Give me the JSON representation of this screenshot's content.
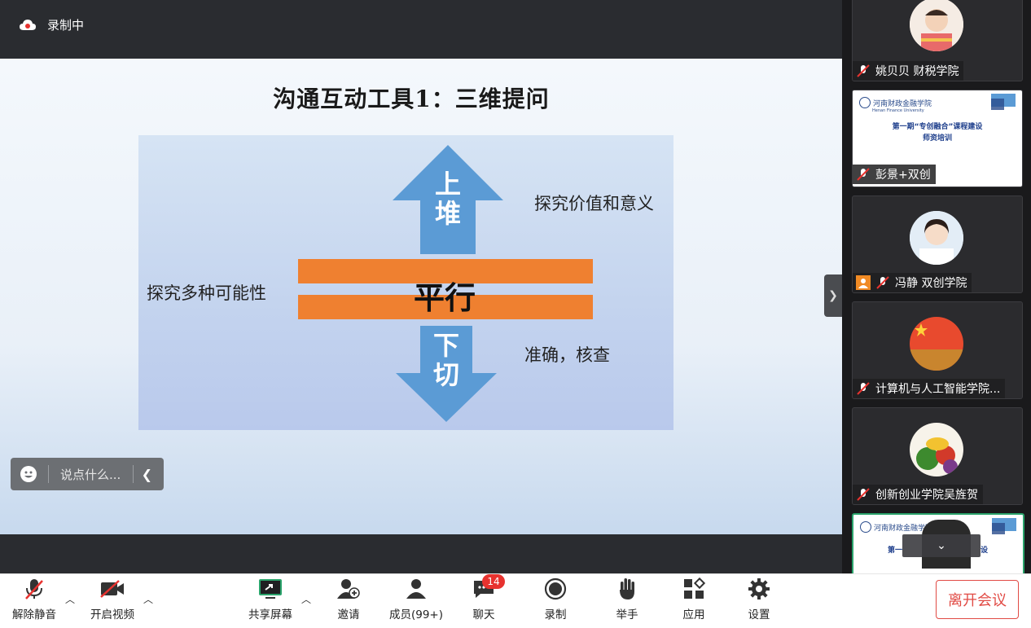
{
  "topbar": {
    "recording_label": "录制中"
  },
  "slide": {
    "title": "沟通互动工具1：三维提问",
    "up_label": "上堆",
    "up_desc": "探究价值和意义",
    "parallel_label": "平行",
    "parallel_desc": "探究多种可能性",
    "down_label": "下切",
    "down_desc": "准确，核查"
  },
  "chat": {
    "placeholder": "说点什么..."
  },
  "participants": [
    {
      "name": "姚贝贝  财税学院"
    },
    {
      "name": "彭景+双创",
      "slide_school": "河南财政金融学院",
      "slide_school_en": "Henan Finance University",
      "slide_title_1": "第一期“专创融合”课程建设",
      "slide_title_2": "师资培训"
    },
    {
      "name": "冯静 双创学院"
    },
    {
      "name": "计算机与人工智能学院..."
    },
    {
      "name": "创新创业学院吴旌贺"
    },
    {
      "name": "",
      "slide_school": "河南财政金融学院",
      "slide_school_en": "Henan Finance University",
      "slide_title_1": "第一",
      "slide_title_2": "设"
    }
  ],
  "toolbar": {
    "unmute": "解除静音",
    "start_video": "开启视频",
    "share_screen": "共享屏幕",
    "invite": "邀请",
    "members": "成员(99+)",
    "chat": "聊天",
    "chat_badge": "14",
    "record": "录制",
    "raise_hand": "举手",
    "apps": "应用",
    "settings": "设置",
    "leave": "离开会议"
  },
  "colors": {
    "accent_orange": "#ef8030",
    "arrow_blue": "#5b9bd5",
    "leave_red": "#e14a44",
    "badge_red": "#e7322f",
    "share_green": "#2aa36b"
  }
}
